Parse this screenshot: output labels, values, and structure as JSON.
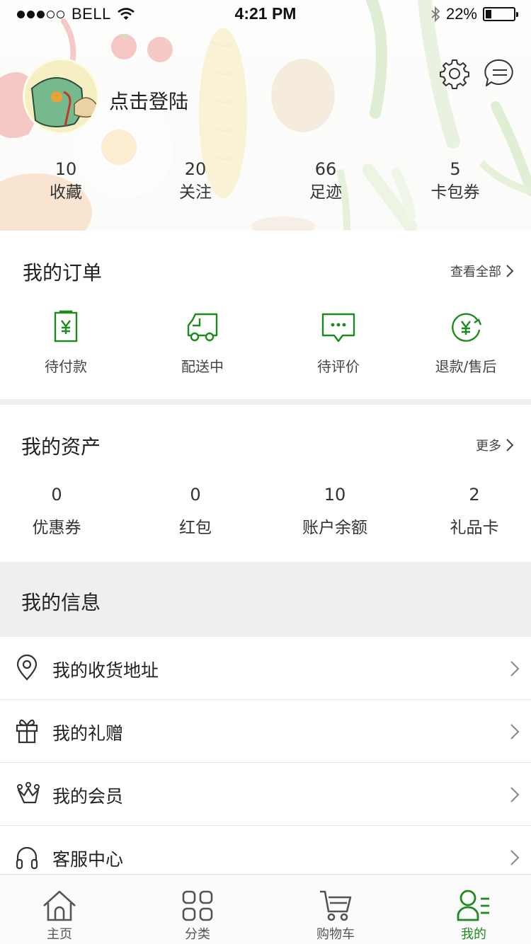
{
  "status_bar": {
    "carrier": "BELL",
    "time": "4:21 PM",
    "battery_percent": "22%",
    "battery_level": 0.22
  },
  "profile": {
    "login_text": "点击登陆",
    "settings_icon": "gear-icon",
    "message_icon": "message-icon"
  },
  "stats": [
    {
      "value": "10",
      "label": "收藏"
    },
    {
      "value": "20",
      "label": "关注"
    },
    {
      "value": "66",
      "label": "足迹"
    },
    {
      "value": "5",
      "label": "卡包券"
    }
  ],
  "orders": {
    "title": "我的订单",
    "view_all": "查看全部",
    "items": [
      {
        "label": "待付款",
        "icon": "payment-pending-icon"
      },
      {
        "label": "配送中",
        "icon": "delivery-truck-icon"
      },
      {
        "label": "待评价",
        "icon": "review-pending-icon"
      },
      {
        "label": "退款/售后",
        "icon": "refund-icon"
      }
    ]
  },
  "assets": {
    "title": "我的资产",
    "more": "更多",
    "items": [
      {
        "value": "0",
        "label": "优惠券"
      },
      {
        "value": "0",
        "label": "红包"
      },
      {
        "value": "10",
        "label": "账户余额"
      },
      {
        "value": "2",
        "label": "礼品卡"
      }
    ]
  },
  "info": {
    "title": "我的信息",
    "items": [
      {
        "label": "我的收货地址",
        "icon": "location-pin-icon"
      },
      {
        "label": "我的礼赠",
        "icon": "gift-icon"
      },
      {
        "label": "我的会员",
        "icon": "membership-crown-icon"
      },
      {
        "label": "客服中心",
        "icon": "headphones-icon"
      }
    ]
  },
  "tabbar": {
    "items": [
      {
        "label": "主页",
        "icon": "home-icon",
        "active": false
      },
      {
        "label": "分类",
        "icon": "category-grid-icon",
        "active": false
      },
      {
        "label": "购物车",
        "icon": "cart-icon",
        "active": false
      },
      {
        "label": "我的",
        "icon": "profile-icon",
        "active": true
      }
    ]
  },
  "colors": {
    "accent": "#1c8a1c",
    "section_gap": "#efefef"
  }
}
